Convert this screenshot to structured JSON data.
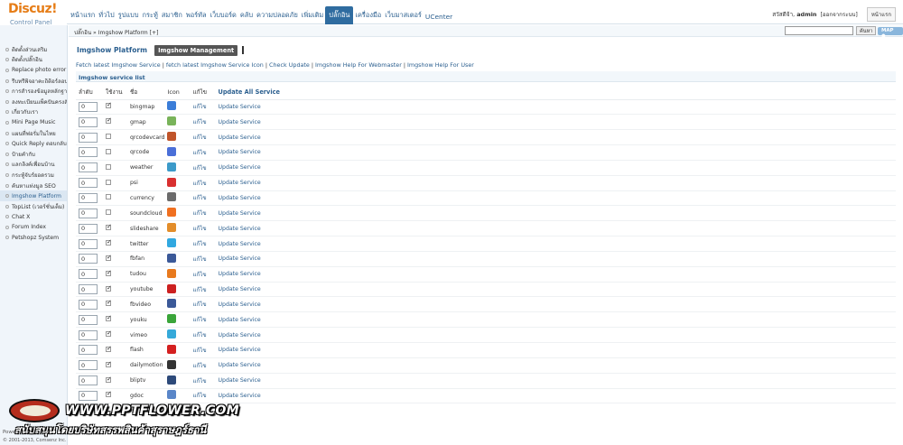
{
  "logo": {
    "name": "Discuz!",
    "subtitle": "Control Panel"
  },
  "nav": {
    "items": [
      "หน้าแรก",
      "ทั่วไป",
      "รูปแบบ",
      "กระทู้",
      "สมาชิก",
      "พอร์ทัล",
      "เว็บบอร์ด",
      "คลับ",
      "ความปลอดภัย",
      "เพิ่มเติม",
      "ปลั๊กอิน",
      "เครื่องมือ",
      "เว็บมาสเตอร์",
      "UCenter"
    ],
    "active_index": 10
  },
  "user": {
    "greeting": "สวัสดีจ้า,",
    "username": "admin",
    "logout": "[ออกจากระบบ]",
    "home_button": "หน้าแรก"
  },
  "sidebar": {
    "items": [
      "ติดตั้งส่วนเสริม",
      "ติดตั้งปลั๊กอิน",
      "Replace photo error",
      "รีบทรีพิจอาคะถิติอร์ลอนลี",
      "การสำรองข้อมูลหลักฐานได้",
      "ลงทะเบียนแพ็คปันครงลัต",
      "เกี่ยวกับเรา",
      "Mini Page Music",
      "แผนที่ฟอรั่มในไทย",
      "Quick Reply ตอบกลับเร็ว",
      "ป้ายคำกับ",
      "แลกลิงค์เพื่อนบ้าน",
      "กระทู้จับร์ยอดรวม",
      "ค้นหาแท่งมูล SEO",
      "Imgshow Platform",
      "TopList (เวอร์ชั่นเต็ม)",
      "Chat X",
      "Forum Index",
      "Petshopz System"
    ],
    "active_index": 14
  },
  "breadcrumb": {
    "text": "ปลั๊กอิน » Imgshow Platform  [+]"
  },
  "search": {
    "button": "ค้นหา",
    "map_button": "MAP ●"
  },
  "page": {
    "title": "Imgshow Platform",
    "active_tab": "Imgshow Management",
    "help_links": [
      "Fetch latest Imgshow Service",
      "fetch latest Imgshow Service Icon",
      "Check Update",
      "Imgshow Help For Webmaster",
      "Imgshow Help For User"
    ],
    "list_title": "Imgshow service list"
  },
  "table": {
    "headers": {
      "order": "ลำดับ",
      "enabled": "ใช้งาน",
      "name": "ชื่อ",
      "icon": "Icon",
      "edit": "แก้ไข",
      "update_all": "Update All Service"
    },
    "edit_label": "แก้ไข",
    "update_label": "Update Service",
    "rows": [
      {
        "order": "0",
        "enabled": true,
        "name": "bingmap",
        "icon": "bing-map-icon",
        "color": "#3b7dd8"
      },
      {
        "order": "0",
        "enabled": true,
        "name": "gmap",
        "icon": "google-map-icon",
        "color": "#79b35a"
      },
      {
        "order": "0",
        "enabled": false,
        "name": "qrcodevcard",
        "icon": "qr-vcard-icon",
        "color": "#c0542a"
      },
      {
        "order": "0",
        "enabled": false,
        "name": "qrcode",
        "icon": "qr-code-icon",
        "color": "#4a6fd8"
      },
      {
        "order": "0",
        "enabled": false,
        "name": "weather",
        "icon": "weather-icon",
        "color": "#3c9ac9"
      },
      {
        "order": "0",
        "enabled": false,
        "name": "psi",
        "icon": "psi-icon",
        "color": "#d93030"
      },
      {
        "order": "0",
        "enabled": false,
        "name": "currency",
        "icon": "currency-icon",
        "color": "#6b6b6b"
      },
      {
        "order": "0",
        "enabled": false,
        "name": "soundcloud",
        "icon": "soundcloud-icon",
        "color": "#f07020"
      },
      {
        "order": "0",
        "enabled": true,
        "name": "slideshare",
        "icon": "slideshare-icon",
        "color": "#e38d2a"
      },
      {
        "order": "0",
        "enabled": true,
        "name": "twitter",
        "icon": "twitter-icon",
        "color": "#31a8e0"
      },
      {
        "order": "0",
        "enabled": true,
        "name": "fbfan",
        "icon": "facebook-icon",
        "color": "#3b5998"
      },
      {
        "order": "0",
        "enabled": true,
        "name": "tudou",
        "icon": "tudou-icon",
        "color": "#e87a1e"
      },
      {
        "order": "0",
        "enabled": true,
        "name": "youtube",
        "icon": "youtube-icon",
        "color": "#cc2020"
      },
      {
        "order": "0",
        "enabled": true,
        "name": "fbvideo",
        "icon": "facebook-icon",
        "color": "#3b5998"
      },
      {
        "order": "0",
        "enabled": true,
        "name": "youku",
        "icon": "youku-icon",
        "color": "#3aa53a"
      },
      {
        "order": "0",
        "enabled": true,
        "name": "vimeo",
        "icon": "vimeo-icon",
        "color": "#35a9d9"
      },
      {
        "order": "0",
        "enabled": true,
        "name": "flash",
        "icon": "flash-icon",
        "color": "#d42020"
      },
      {
        "order": "0",
        "enabled": true,
        "name": "dailymotion",
        "icon": "dailymotion-icon",
        "color": "#333333"
      },
      {
        "order": "0",
        "enabled": true,
        "name": "bliptv",
        "icon": "bliptv-icon",
        "color": "#2d4a7a"
      },
      {
        "order": "0",
        "enabled": true,
        "name": "gdoc",
        "icon": "google-doc-icon",
        "color": "#5a86c8"
      }
    ]
  },
  "watermark": {
    "url": "WWW.PPTFLOWER.COM",
    "subtitle": "สนับสนุนโดยบริษัทสรรพสินค้าสุราษฎร์ธานี"
  },
  "footer": {
    "powered": "Powered by Discuz!",
    "copyright": "© 2001-2013, Comsenz Inc."
  }
}
